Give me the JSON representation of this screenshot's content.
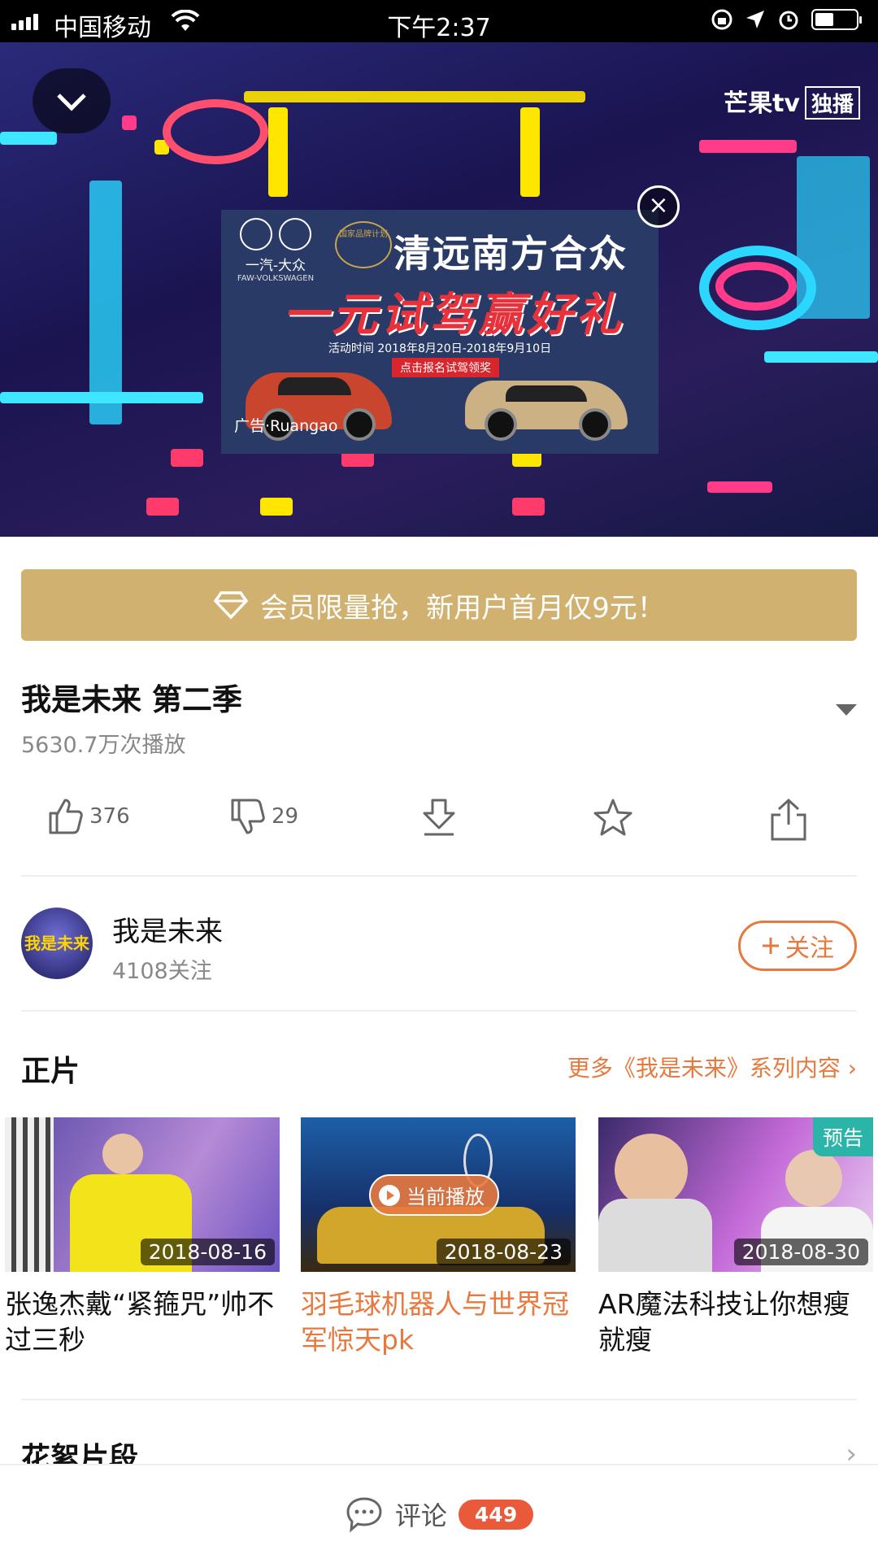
{
  "status_bar": {
    "carrier": "中国移动",
    "time": "下午2:37",
    "battery_level": 0.45
  },
  "video": {
    "logo": "芒果tv",
    "logo_tag": "独播",
    "ad": {
      "brand": "一汽-大众",
      "brand_en": "FAW-VOLKSWAGEN",
      "badge": "国家品牌计划",
      "title": "清远南方合众",
      "headline": "一元试驾赢好礼",
      "date_text": "活动时间 2018年8月20日-2018年9月10日",
      "cta": "点击报名试驾领奖",
      "label": "广告·Ruangao"
    }
  },
  "vip_banner": {
    "text": "会员限量抢，新用户首月仅9元！"
  },
  "show": {
    "title": "我是未来 第二季",
    "plays": "5630.7万次播放"
  },
  "actions": {
    "like_count": "376",
    "dislike_count": "29"
  },
  "channel": {
    "avatar_text": "我是未来",
    "name": "我是未来",
    "followers": "4108关注",
    "follow_label": "关注"
  },
  "episodes_section": {
    "title": "正片",
    "more": "更多《我是未来》系列内容",
    "playing_label": "当前播放",
    "preview_label": "预告",
    "items": [
      {
        "date": "2018-08-16",
        "title": "张逸杰戴“紧箍咒”帅不过三秒"
      },
      {
        "date": "2018-08-23",
        "title": "羽毛球机器人与世界冠军惊天pk"
      },
      {
        "date": "2018-08-30",
        "title": "AR魔法科技让你想瘦就瘦"
      }
    ]
  },
  "clips_section": {
    "title": "花絮片段"
  },
  "comment_bar": {
    "label": "评论",
    "count": "449"
  },
  "colors": {
    "accent": "#e8793e",
    "vip_gold": "#d1b170",
    "comment_badge": "#e85a3a",
    "preview_tag": "#2bb5a8"
  }
}
